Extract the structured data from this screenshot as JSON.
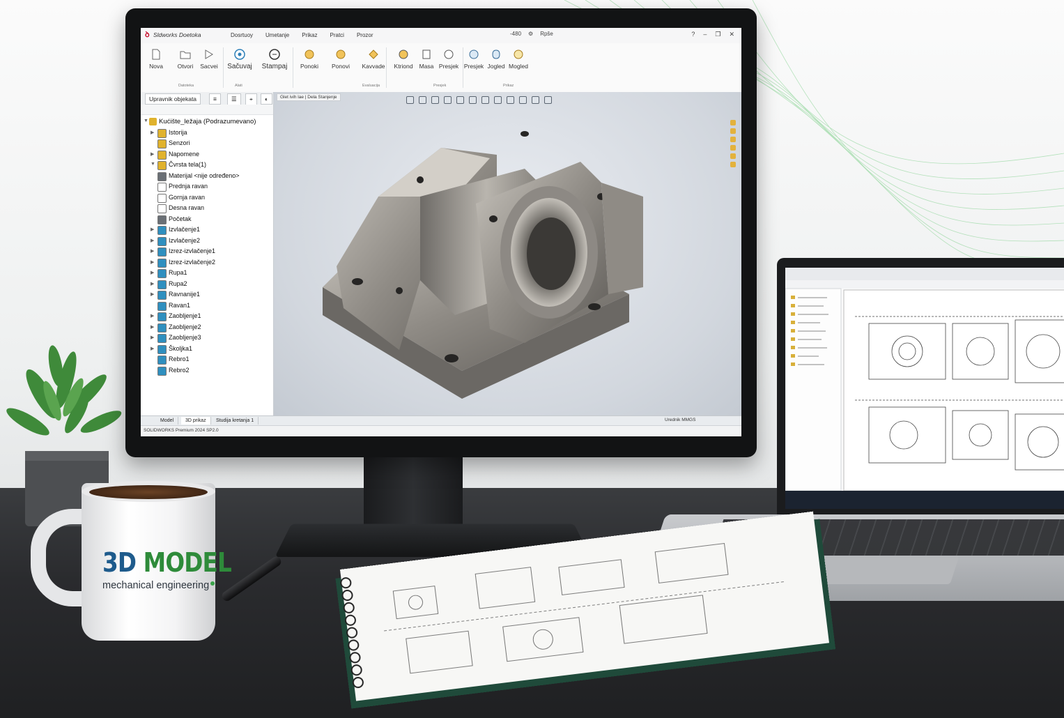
{
  "app": {
    "title": "Sldworks Doetoka",
    "menu": [
      "Dosrtuoy",
      "Umetanje",
      "Prikaz",
      "Pratci",
      "Prozor"
    ],
    "quick_access": [
      "-480",
      "Rpše"
    ]
  },
  "ribbon": {
    "buttons": [
      {
        "label": "Nova",
        "icon": "new-document-icon"
      },
      {
        "label": "Otvori",
        "icon": "open-folder-icon"
      },
      {
        "label": "Sacvei",
        "icon": "save-icon"
      },
      {
        "label": "Sačuvaj",
        "icon": "save-circle-icon"
      },
      {
        "label": "Stampaj",
        "icon": "print-icon"
      },
      {
        "label": "Ponoki",
        "icon": "undo-icon"
      },
      {
        "label": "Ponovi",
        "icon": "redo-icon"
      },
      {
        "label": "Kavvade",
        "icon": "commands-icon"
      },
      {
        "label": "Ktriond",
        "icon": "measure-icon"
      },
      {
        "label": "Masa",
        "icon": "mass-icon"
      },
      {
        "label": "Presjek",
        "icon": "section-icon"
      },
      {
        "label": "Presjek",
        "icon": "section-view-icon"
      },
      {
        "label": "Jogled",
        "icon": "view-icon"
      },
      {
        "label": "Mogled",
        "icon": "appearance-icon"
      }
    ],
    "groups": [
      "Datoteka",
      "Alati",
      "Evaluacija",
      "Presjek",
      "Prikaz"
    ]
  },
  "feature_manager": {
    "tabs": [
      "Upravnik objekata"
    ],
    "root": "Kućište_ležaja  (Podrazumevano)",
    "items": [
      {
        "label": "Istorija",
        "icon": "history-icon",
        "color": "#e0b22d",
        "expand": true
      },
      {
        "label": "Senzori",
        "icon": "sensor-icon",
        "color": "#e0b22d",
        "expand": false
      },
      {
        "label": "Napomene",
        "icon": "annotations-icon",
        "color": "#e0b22d",
        "expand": true
      },
      {
        "label": "Čvrsta tela(1)",
        "icon": "solid-bodies-icon",
        "color": "#e0b22d",
        "expand": true
      },
      {
        "label": "Materijal <nije određeno>",
        "icon": "material-icon",
        "color": "#6a6f75",
        "expand": false
      },
      {
        "label": "Prednja ravan",
        "icon": "plane-icon",
        "color": "#ffffff",
        "expand": false
      },
      {
        "label": "Gornja ravan",
        "icon": "plane-icon",
        "color": "#ffffff",
        "expand": false
      },
      {
        "label": "Desna ravan",
        "icon": "plane-icon",
        "color": "#ffffff",
        "expand": false
      },
      {
        "label": "Početak",
        "icon": "origin-icon",
        "color": "#6a6f75",
        "expand": false
      },
      {
        "label": "Izvlačenje1",
        "icon": "extrude-icon",
        "color": "#2f8fbf",
        "expand": true
      },
      {
        "label": "Izvlačenje2",
        "icon": "extrude-icon",
        "color": "#2f8fbf",
        "expand": true
      },
      {
        "label": "Izrez-izvlačenje1",
        "icon": "cut-extrude-icon",
        "color": "#2f8fbf",
        "expand": true
      },
      {
        "label": "Izrez-izvlačenje2",
        "icon": "cut-extrude-icon",
        "color": "#2f8fbf",
        "expand": true
      },
      {
        "label": "Rupa1",
        "icon": "hole-icon",
        "color": "#2f8fbf",
        "expand": true
      },
      {
        "label": "Rupa2",
        "icon": "hole-icon",
        "color": "#2f8fbf",
        "expand": true
      },
      {
        "label": "Ravnanije1",
        "icon": "draft-icon",
        "color": "#2f8fbf",
        "expand": true
      },
      {
        "label": "Ravan1",
        "icon": "plane-icon",
        "color": "#2f8fbf",
        "expand": false
      },
      {
        "label": "Zaobljenje1",
        "icon": "fillet-icon",
        "color": "#2f8fbf",
        "expand": true
      },
      {
        "label": "Zaobljenje2",
        "icon": "fillet-icon",
        "color": "#2f8fbf",
        "expand": true
      },
      {
        "label": "Zaobljenje3",
        "icon": "fillet-icon",
        "color": "#2f8fbf",
        "expand": true
      },
      {
        "label": "Školjka1",
        "icon": "shell-icon",
        "color": "#2f8fbf",
        "expand": true
      },
      {
        "label": "Rebro1",
        "icon": "rib-icon",
        "color": "#2f8fbf",
        "expand": false
      },
      {
        "label": "Rebro2",
        "icon": "rib-icon",
        "color": "#2f8fbf",
        "expand": false
      }
    ]
  },
  "viewport": {
    "view_tab": "Glet ivih lae | Dela Stanjenje"
  },
  "bottom_tabs": [
    "Model",
    "3D prikaz",
    "Studija kretanja 1"
  ],
  "status": {
    "version": "SOLIDWORKS Premium 2024 SP2.0",
    "right": "Urednik MMGS"
  },
  "mug": {
    "title_part1": "3D",
    "title_part2": "MODEL",
    "subtitle": "mechanical engineering"
  },
  "colors": {
    "accent_blue": "#1e5b8c",
    "accent_green": "#2e8b3a"
  }
}
